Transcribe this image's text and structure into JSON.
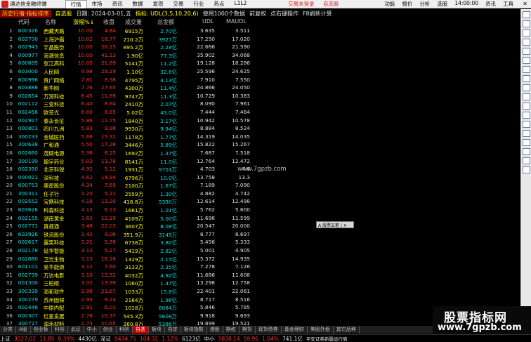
{
  "titlebar": {
    "app_title": "通达信金融终端",
    "menu": [
      "行情",
      "市场",
      "资讯",
      "数据",
      "发现",
      "交易",
      "行业",
      "热点",
      "L1L2"
    ],
    "center_links": [
      "交易未登录",
      "自选股"
    ],
    "right_menu": [
      "功能",
      "报价",
      "分析",
      "选股",
      "14:00:00",
      "资讯",
      "工具"
    ],
    "close_glyph": "✕"
  },
  "infobar": {
    "tag": "历史行情·指标排序",
    "group": "自选股",
    "date": "日期: 2024-03-01,五",
    "indicator": "指标: UDL(3,5,10,20,6)",
    "note1": "使用1000个数据",
    "note2": "前复权",
    "note3": "点右键操作",
    "note4": "F8刷新计算"
  },
  "columns": {
    "code": "代码",
    "name": "名称",
    "chg": "涨幅%↓",
    "price": "收盘",
    "vol": "成交量",
    "amt": "总金额",
    "udl": "UDL",
    "maudl": "MAUDL"
  },
  "rows": [
    {
      "idx": "1",
      "code": "600326",
      "name": "西藏天路",
      "chg": "10.00",
      "price": "4.84",
      "vol": "6915万",
      "amt": "2.70亿",
      "udl": "3.635",
      "maudl": "3.511"
    },
    {
      "idx": "2",
      "code": "603700",
      "name": "上海沪霸",
      "chg": "10.02",
      "price": "18.77",
      "vol": "210.2万",
      "amt": "3927万",
      "udl": "17.250",
      "maudl": "17.020"
    },
    {
      "idx": "3",
      "code": "002943",
      "name": "宇晶股份",
      "chg": "10.00",
      "price": "26.25",
      "vol": "895.2万",
      "amt": "2.28亿",
      "udl": "22.666",
      "maudl": "21.590"
    },
    {
      "idx": "4",
      "code": "000977",
      "name": "浪潮信息",
      "chg": "10.00",
      "price": "41.13",
      "vol": "1.90亿",
      "amt": "77.3亿",
      "udl": "35.902",
      "maudl": "34.068"
    },
    {
      "idx": "5",
      "code": "600895",
      "name": "张江高科",
      "chg": "10.00",
      "price": "21.89",
      "vol": "5141万",
      "amt": "11.2亿",
      "udl": "19.128",
      "maudl": "18.286"
    },
    {
      "idx": "6",
      "code": "603000",
      "name": "人民网",
      "chg": "9.98",
      "price": "29.19",
      "vol": "1.10亿",
      "amt": "32.6亿",
      "udl": "25.596",
      "maudl": "24.625"
    },
    {
      "idx": "7",
      "code": "600996",
      "name": "贵广网络",
      "chg": "7.81",
      "price": "8.56",
      "vol": "4795万",
      "amt": "4.13亿",
      "udl": "7.910",
      "maudl": "7.550"
    },
    {
      "idx": "8",
      "code": "603888",
      "name": "新华网",
      "chg": "7.76",
      "price": "27.65",
      "vol": "4300万",
      "amt": "11.4亿",
      "udl": "24.866",
      "maudl": "24.050"
    },
    {
      "idx": "9",
      "code": "002654",
      "name": "万润科技",
      "chg": "6.45",
      "price": "11.89",
      "vol": "9747万",
      "amt": "11.3亿",
      "udl": "10.729",
      "maudl": "10.383"
    },
    {
      "idx": "10",
      "code": "002112",
      "name": "三变科技",
      "chg": "6.40",
      "price": "8.64",
      "vol": "2410万",
      "amt": "2.07亿",
      "udl": "8.090",
      "maudl": "7.961"
    },
    {
      "idx": "11",
      "code": "002456",
      "name": "欧菲光",
      "chg": "6.00",
      "price": "8.65",
      "vol": "5.02亿",
      "amt": "43.0亿",
      "udl": "7.444",
      "maudl": "7.464"
    },
    {
      "idx": "12",
      "code": "002927",
      "name": "泰永长征",
      "chg": "5.86",
      "price": "11.75",
      "vol": "1840万",
      "amt": "2.17亿",
      "udl": "10.942",
      "maudl": "10.578"
    },
    {
      "idx": "13",
      "code": "000801",
      "name": "四川九洲",
      "chg": "5.83",
      "price": "9.98",
      "vol": "9930万",
      "amt": "9.94亿",
      "udl": "8.884",
      "maudl": "8.524"
    },
    {
      "idx": "14",
      "code": "300233",
      "name": "金城医药",
      "chg": "5.66",
      "price": "15.31",
      "vol": "1178万",
      "amt": "1.77亿",
      "udl": "14.319",
      "maudl": "14.035"
    },
    {
      "idx": "15",
      "code": "300638",
      "name": "广和通",
      "chg": "5.50",
      "price": "17.26",
      "vol": "3446万",
      "amt": "5.89亿",
      "udl": "15.822",
      "maudl": "15.267"
    },
    {
      "idx": "16",
      "code": "002660",
      "name": "茂硕电源",
      "chg": "5.36",
      "price": "8.25",
      "vol": "1692万",
      "amt": "1.37亿",
      "udl": "7.687",
      "maudl": "7.518"
    },
    {
      "idx": "17",
      "code": "300199",
      "name": "翰宇药业",
      "chg": "5.03",
      "price": "13.78",
      "vol": "8141万",
      "amt": "11.0亿",
      "udl": "12.764",
      "maudl": "12.472"
    },
    {
      "idx": "18",
      "code": "002350",
      "name": "北京科锐",
      "chg": "4.92",
      "price": "5.12",
      "vol": "1931万",
      "amt": "9701万",
      "udl": "4.703",
      "maudl": "4.6"
    },
    {
      "idx": "19",
      "code": "000021",
      "name": "深科技",
      "chg": "4.62",
      "price": "14.94",
      "vol": "6796万",
      "amt": "10.0亿",
      "udl": "13.758",
      "maudl": "13.3"
    },
    {
      "idx": "20",
      "code": "600753",
      "name": "庚星股份",
      "chg": "4.34",
      "price": "7.69",
      "vol": "2100万",
      "amt": "1.67亿",
      "udl": "7.189",
      "maudl": "7.090"
    },
    {
      "idx": "21",
      "code": "300311",
      "name": "任子行",
      "chg": "4.20",
      "price": "5.21",
      "vol": "2559万",
      "amt": "1.30亿",
      "udl": "4.882",
      "maudl": "4.742"
    },
    {
      "idx": "22",
      "code": "002552",
      "name": "宝鼎科技",
      "chg": "4.18",
      "price": "13.20",
      "vol": "416.8万",
      "amt": "5390万",
      "udl": "12.614",
      "maudl": "12.498"
    },
    {
      "idx": "23",
      "code": "603626",
      "name": "科森科技",
      "chg": "4.13",
      "price": "6.13",
      "vol": "1661万",
      "amt": "1.01亿",
      "udl": "5.762",
      "maudl": "5.600"
    },
    {
      "idx": "24",
      "code": "002155",
      "name": "湖南黄金",
      "chg": "3.63",
      "price": "12.19",
      "vol": "4109万",
      "amt": "5.00亿",
      "udl": "11.698",
      "maudl": "11.599"
    },
    {
      "idx": "25",
      "code": "002771",
      "name": "真视通",
      "chg": "3.48",
      "price": "22.03",
      "vol": "3607万",
      "amt": "8.08亿",
      "udl": "20.547",
      "maudl": "20.000"
    },
    {
      "idx": "26",
      "code": "603926",
      "name": "铁流股份",
      "chg": "3.42",
      "price": "9.06",
      "vol": "351.9万",
      "amt": "3145万",
      "udl": "8.777",
      "maudl": "8.697"
    },
    {
      "idx": "27",
      "code": "002617",
      "name": "露笑科技",
      "chg": "3.21",
      "price": "5.78",
      "vol": "6738万",
      "amt": "3.80亿",
      "udl": "5.456",
      "maudl": "5.333"
    },
    {
      "idx": "28",
      "code": "002178",
      "name": "延华智能",
      "chg": "3.13",
      "price": "5.27",
      "vol": "5419万",
      "amt": "2.82亿",
      "udl": "5.001",
      "maudl": "4.905"
    },
    {
      "idx": "29",
      "code": "002880",
      "name": "卫光生物",
      "chg": "3.13",
      "price": "16.16",
      "vol": "1329万",
      "amt": "2.15亿",
      "udl": "15.372",
      "maudl": "14.935"
    },
    {
      "idx": "30",
      "code": "601101",
      "name": "昊华能源",
      "chg": "3.12",
      "price": "7.60",
      "vol": "3133万",
      "amt": "2.35亿",
      "udl": "7.278",
      "maudl": "7.126"
    },
    {
      "idx": "31",
      "code": "002739",
      "name": "万达电影",
      "chg": "3.10",
      "price": "12.32",
      "vol": "4032万",
      "amt": "4.92亿",
      "udl": "11.686",
      "maudl": "11.608"
    },
    {
      "idx": "32",
      "code": "001300",
      "name": "三柏硕",
      "chg": "3.02",
      "price": "13.99",
      "vol": "1060万",
      "amt": "1.47亿",
      "udl": "13.298",
      "maudl": "12.758"
    },
    {
      "idx": "33",
      "code": "300339",
      "name": "润和软件",
      "chg": "2.96",
      "price": "23.67",
      "vol": "1033万",
      "amt": "15.8亿",
      "udl": "22.401",
      "maudl": "22.061"
    },
    {
      "idx": "34",
      "code": "300279",
      "name": "苏州固锝",
      "chg": "2.93",
      "price": "9.14",
      "vol": "2164万",
      "amt": "1.96亿",
      "udl": "8.717",
      "maudl": "8.516"
    },
    {
      "idx": "35",
      "code": "002448",
      "name": "中原内配",
      "chg": "2.91",
      "price": "6.01",
      "vol": "1018万",
      "amt": "6084万",
      "udl": "5.846",
      "maudl": "5.785"
    },
    {
      "idx": "36",
      "code": "000307",
      "name": "红星发展",
      "chg": "2.78",
      "price": "10.37",
      "vol": "545.3万",
      "amt": "5608万",
      "udl": "9.918",
      "maudl": "9.693"
    },
    {
      "idx": "37",
      "code": "300727",
      "name": "润禾材料",
      "chg": "2.74",
      "price": "20.65",
      "vol": "260.8万",
      "amt": "5386万",
      "udl": "19.899",
      "maudl": "19.521"
    }
  ],
  "watermark": "www.7gpzb.com",
  "floatbox": "A 股票五笔 | ✕",
  "tabs": [
    "分类",
    "A股",
    "创业板",
    "科创",
    "北证",
    "中小",
    "创业",
    "科创",
    "自选",
    "板块",
    "自定",
    "板块指数",
    "港股",
    "期权",
    "期货",
    "现货债券",
    "基金理财",
    "美股外盘",
    "其它品种"
  ],
  "active_tab": "自选",
  "status": {
    "sh_name": "上证",
    "sh_val": "3027.02",
    "sh_chg": "11.85",
    "sh_pct": "0.39%",
    "sh_amt": "4430亿",
    "sz_name": "深证",
    "sz_val": "9434.75",
    "sz_chg": "104.31",
    "sz_pct": "1.12%",
    "sz_amt": "6123亿",
    "zx_name": "中小",
    "zx_val": "5838.14",
    "zx_chg": "59.95",
    "zx_pct": "1.04%",
    "zx_amt": "741.1亿",
    "broker": "平安证券新疆运行情"
  },
  "ad": {
    "line1": "股票指标网",
    "line2": "www.7gpzb.com"
  },
  "colors": {
    "up": "#ff3030",
    "cyan": "#00e0e0",
    "yellow": "#ffff00",
    "active_tab": "#c00000"
  }
}
